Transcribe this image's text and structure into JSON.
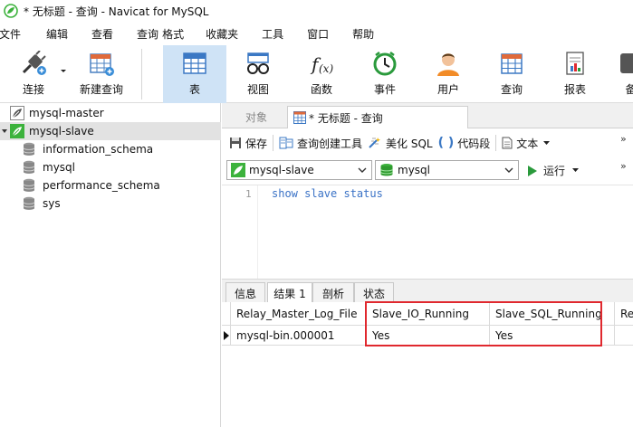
{
  "window": {
    "title": "* 无标题 - 查询 - Navicat for MySQL"
  },
  "menu": [
    "文件",
    "编辑",
    "查看",
    "查询",
    "格式",
    "收藏夹",
    "工具",
    "窗口",
    "帮助"
  ],
  "toolbar": {
    "buttons": [
      "连接",
      "新建查询",
      "表",
      "视图",
      "函数",
      "事件",
      "用户",
      "查询",
      "报表",
      "备"
    ],
    "active": "表"
  },
  "tree": {
    "connections": [
      "mysql-master",
      "mysql-slave"
    ],
    "databases": [
      "information_schema",
      "mysql",
      "performance_schema",
      "sys"
    ],
    "selected": "mysql-slave"
  },
  "tabs": {
    "objects": "对象",
    "query": "* 无标题 - 查询"
  },
  "query_toolbar": {
    "save": "保存",
    "builder": "查询创建工具",
    "beautify": "美化 SQL",
    "snippet": "代码段",
    "text": "文本"
  },
  "selectors": {
    "connection": "mysql-slave",
    "database": "mysql",
    "run": "运行"
  },
  "editor": {
    "line": "1",
    "code": "show slave status"
  },
  "result_tabs": [
    "信息",
    "结果 1",
    "剖析",
    "状态"
  ],
  "grid": {
    "columns": [
      "Relay_Master_Log_File",
      "Slave_IO_Running",
      "Slave_SQL_Running",
      "Re"
    ],
    "rows": [
      [
        "mysql-bin.000001",
        "Yes",
        "Yes",
        ""
      ]
    ]
  },
  "colors": {
    "accent": "#cfe3f6",
    "highlight": "#e0282e",
    "code": "#3a72c6",
    "leaf": "#3cb23c"
  }
}
